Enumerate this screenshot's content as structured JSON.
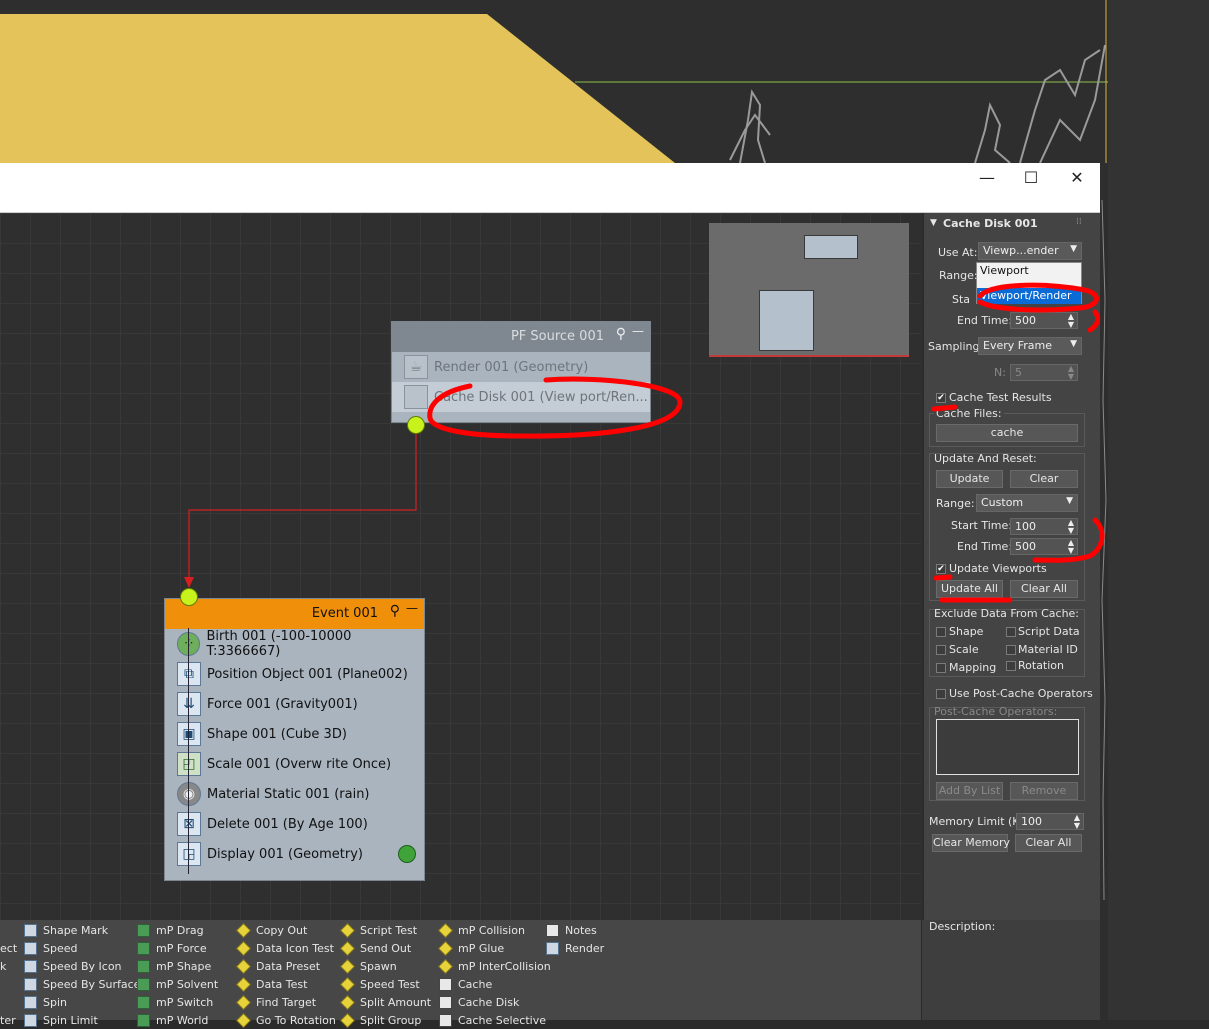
{
  "window_controls": {
    "minimize": "—",
    "maximize": "☐",
    "close": "✕"
  },
  "source_node": {
    "title": "PF Source 001",
    "rows": [
      "Render 001 (Geometry)",
      "Cache Disk 001 (View port/Ren..."
    ]
  },
  "event_node": {
    "title": "Event 001",
    "rows": [
      "Birth 001 (-100-10000 T:3366667)",
      "Position Object 001 (Plane002)",
      "Force 001 (Gravity001)",
      "Shape 001 (Cube 3D)",
      "Scale 001 (Overw rite Once)",
      "Material Static 001 (rain)",
      "Delete 001 (By Age 100)",
      "Display 001 (Geometry)"
    ]
  },
  "panel": {
    "title": "Cache Disk 001",
    "use_at_label": "Use At:",
    "use_at_value": "Viewp...ender",
    "use_at_options": [
      "Viewport",
      "Viewport/Render"
    ],
    "range_label": "Range:",
    "start_label": "Sta",
    "end_time_label": "End Time:",
    "end_time_value": "500",
    "sampling_label": "Sampling:",
    "sampling_value": "Every Frame",
    "n_label": "N:",
    "n_value": "5",
    "cache_test_results": "Cache Test Results",
    "cache_files_label": "Cache Files:",
    "cache_button": "cache",
    "update_reset_label": "Update And Reset:",
    "update_button": "Update",
    "clear_button": "Clear",
    "range2_label": "Range:",
    "range2_value": "Custom",
    "start_time_label": "Start Time:",
    "start_time_value": "100",
    "end_time2_label": "End Time:",
    "end_time2_value": "500",
    "update_viewports": "Update Viewports",
    "update_all_button": "Update All",
    "clear_all_button": "Clear All",
    "exclude_label": "Exclude Data From Cache:",
    "exclude_items": [
      "Shape",
      "Script Data",
      "Scale",
      "Material ID",
      "Mapping",
      "Rotation"
    ],
    "use_post_cache": "Use Post-Cache Operators",
    "post_cache_label": "Post-Cache Operators:",
    "add_by_list": "Add By List",
    "remove": "Remove",
    "memory_limit_label": "Memory Limit (K):",
    "memory_limit_value": "100",
    "clear_memory": "Clear Memory",
    "clear_all2": "Clear All"
  },
  "description_label": "Description:",
  "depot": {
    "col0": [
      "",
      "ect",
      "k",
      "",
      "ter"
    ],
    "col1": [
      "Shape Mark",
      "Speed",
      "Speed By Icon",
      "Speed By Surface",
      "Spin",
      "Spin Limit"
    ],
    "col2": [
      "mP Drag",
      "mP Force",
      "mP Shape",
      "mP Solvent",
      "mP Switch",
      "mP World"
    ],
    "col3": [
      "Copy Out",
      "Data Icon Test",
      "Data Preset",
      "Data Test",
      "Find Target",
      "Go To Rotation"
    ],
    "col4": [
      "Script Test",
      "Send Out",
      "Spawn",
      "Speed Test",
      "Split Amount",
      "Split Group"
    ],
    "col5": [
      "mP Collision",
      "mP Glue",
      "mP InterCollision",
      "Cache",
      "Cache Disk",
      "Cache Selective"
    ],
    "col6": [
      "Notes",
      "Render"
    ]
  },
  "colors": {
    "yellow": "#e3c35a",
    "event_header": "#f0900a",
    "port": "#c8f21b",
    "wire": "#d42020",
    "annotation": "#ff0000",
    "selection": "#0a6bd6"
  }
}
